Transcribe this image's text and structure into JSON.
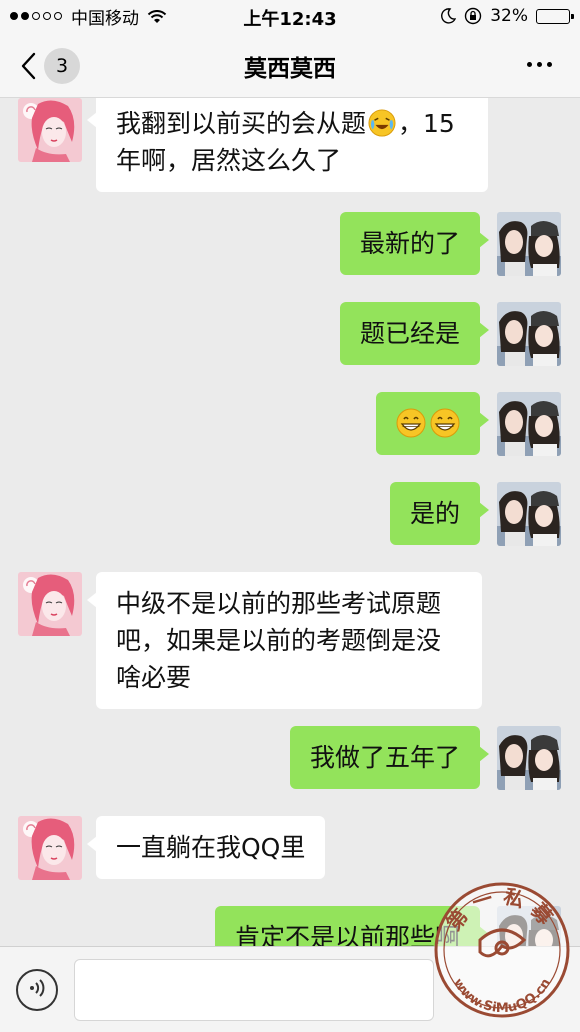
{
  "status_bar": {
    "carrier": "中国移动",
    "time": "上午12:43",
    "battery_percent": "32%",
    "battery_level": 0.32,
    "signal_bars_filled": 2,
    "signal_bars_total": 5
  },
  "nav": {
    "title": "莫西莫西",
    "unread_count": "3"
  },
  "messages": [
    {
      "side": "left",
      "lines": [
        "我翻到以前买的会从题",
        "，15",
        "年啊，居然这么久了"
      ],
      "emoji": "crying-laughing-emoji"
    },
    {
      "side": "right",
      "text": "最新的了"
    },
    {
      "side": "right",
      "text": "题已经是"
    },
    {
      "side": "right",
      "emoji": [
        "grinning-emoji",
        "grinning-emoji"
      ]
    },
    {
      "side": "right",
      "text": "是的"
    },
    {
      "side": "left",
      "lines": [
        "中级不是以前的那些考试原题",
        "吧，如果是以前的考题倒是没",
        "啥必要"
      ]
    },
    {
      "side": "right",
      "text": "我做了五年了"
    },
    {
      "side": "left",
      "text": "一直躺在我QQ里"
    },
    {
      "side": "right",
      "text": "肯定不是以前那些啊"
    }
  ],
  "input": {
    "placeholder": ""
  },
  "watermark": {
    "text_top": "第一私募",
    "text_bottom": "www.SiMuQQ.cn"
  },
  "colors": {
    "background": "#ebebeb",
    "bubble_sent": "#93e35b",
    "bubble_received": "#ffffff",
    "header": "#f6f6f6"
  }
}
